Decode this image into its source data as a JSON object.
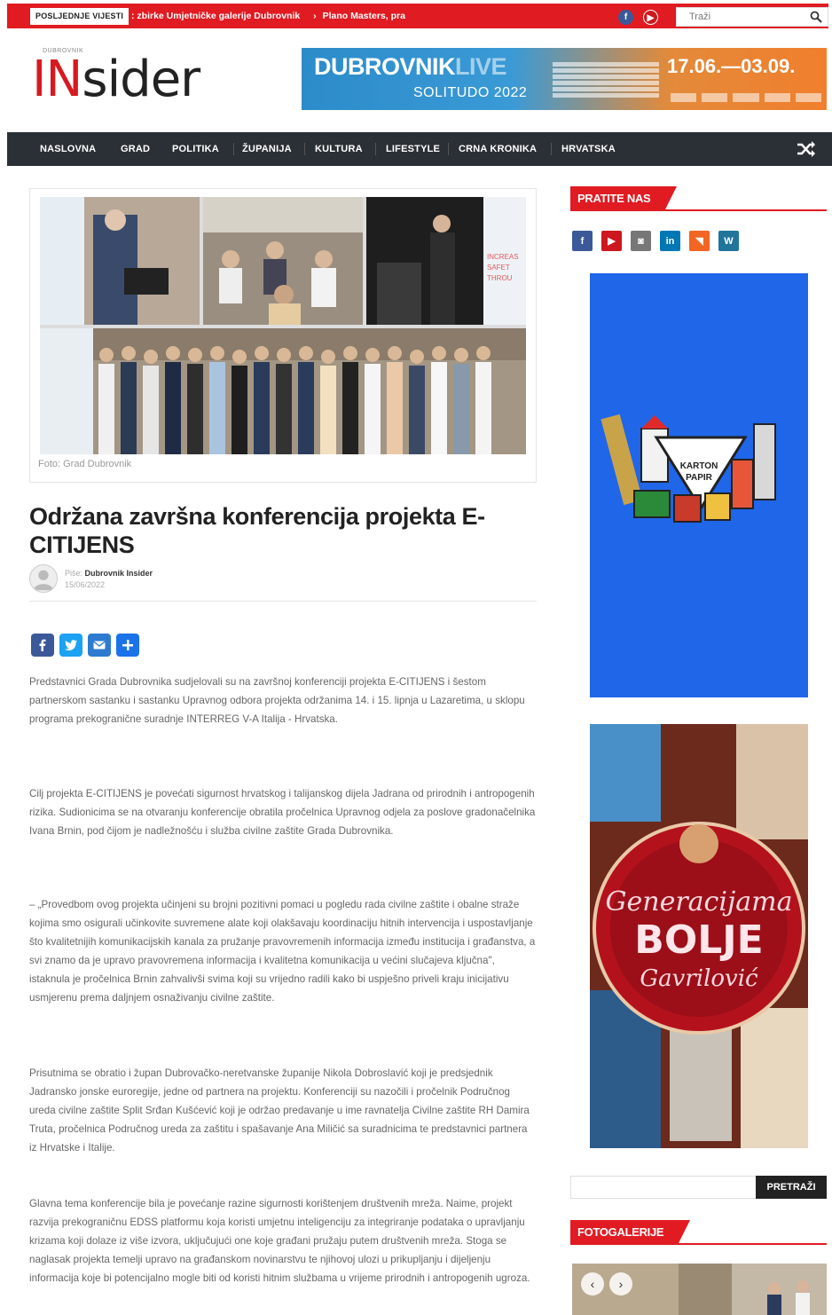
{
  "topbar": {
    "latest_label": "POSLJEDNJE VIJESTI",
    "ticker": [
      ": zbirke Umjetničke galerije Dubrovnik",
      "Plano Masters, pra"
    ],
    "search_placeholder": "Traži",
    "social_icons": [
      "facebook-icon",
      "youtube-icon"
    ]
  },
  "header": {
    "logo_small": "DUBROVNIK",
    "logo_in": "IN",
    "logo_sider": "sider",
    "banner": {
      "title_a": "DUBROVNIK",
      "title_b": "LIVE",
      "subtitle": "SOLITUDO 2022",
      "dates": "17.06.—03.09."
    }
  },
  "nav": {
    "items": [
      "NASLOVNA",
      "GRAD",
      "POLITIKA",
      "ŽUPANIJA",
      "KULTURA",
      "LIFESTYLE",
      "CRNA KRONIKA",
      "HRVATSKA"
    ]
  },
  "article": {
    "photo_caption": "Foto: Grad Dubrovnik",
    "collage_text": "INCREASING SAFETY THROUGH SOCIAL MEDIA BASED TOOLS",
    "title": "Održana završna konferencija projekta E-CITIJENS",
    "author_prefix": "Piše:",
    "author": "Dubrovnik Insider",
    "date": "15/06/2022",
    "paragraphs": [
      "Predstavnici Grada Dubrovnika sudjelovali su na završnoj konferenciji projekta E-CITIJENS i šestom partnerskom sastanku i sastanku Upravnog odbora projekta održanima 14. i 15. lipnja u Lazaretima, u sklopu programa prekogranične suradnje INTERREG V-A Italija - Hrvatska.",
      "Cilj projekta E-CITIJENS  je povećati sigurnost hrvatskog i talijanskog dijela Jadrana od prirodnih i antropogenih rizika. Sudionicima se na otvaranju konferencije obratila pročelnica Upravnog odjela za poslove gradonačelnika Ivana Brnin, pod čijom je nadležnošću i služba civilne zaštite Grada Dubrovnika.",
      "–  „Provedbom ovog projekta učinjeni su brojni pozitivni pomaci u pogledu rada civilne zaštite i obalne straže kojima smo osigurali učinkovite suvremene alate koji olakšavaju koordinaciju hitnih intervencija i uspostavljanje što kvalitetnijih komunikacijskih kanala za pružanje pravovremenih informacija između institucija i građanstva, a svi znamo da je upravo pravovremena informacija i kvalitetna komunikacija u većini slučajeva ključna\", istaknula je pročelnica Brnin zahvalivši svima koji su vrijedno radili kako bi uspješno priveli kraju inicijativu usmjerenu prema daljnjem osnaživanju civilne zaštite.",
      "Prisutnima se obratio i župan Dubrovačko-neretvanske županije Nikola Dobroslavić koji je predsjednik Jadransko jonske euroregije, jedne od partnera na projektu. Konferenciji su nazočili i pročelnik Područnog ureda civilne zaštite Split Srđan Kušćević koji je održao predavanje u ime ravnatelja Civilne zaštite RH Damira Truta, pročelnica Područnog ureda za zaštitu i spašavanje Ana Miličić sa suradnicima te predstavnici partnera iz Hrvatske i Italije.",
      "Glavna tema konferencije bila je povećanje razine sigurnosti korištenjem društvenih mreža. Naime, projekt razvija prekograničnu EDSS platformu koja koristi umjetnu inteligenciju za integriranje podataka o upravljanju krizama koji dolaze iz više izvora, uključujući one koje građani pružaju putem društvenih mreža. Stoga se naglasak projekta temelji upravo na građanskom novinarstvu te njihovoj ulozi u prikupljanju i dijeljenju informacija koje bi potencijalno mogle biti od koristi hitnim službama u vrijeme prirodnih i antropogenih ugroza."
    ],
    "share_icons": [
      "facebook-share-icon",
      "twitter-share-icon",
      "email-share-icon",
      "add-share-icon"
    ]
  },
  "sidebar": {
    "follow_title": "PRATITE NAS",
    "follow_icons": [
      {
        "name": "facebook-icon",
        "glyph": "f",
        "color": "#3b5998"
      },
      {
        "name": "youtube-icon",
        "glyph": "▶",
        "color": "#cc181e"
      },
      {
        "name": "instagram-icon",
        "glyph": "◙",
        "color": "#777777"
      },
      {
        "name": "linkedin-icon",
        "glyph": "in",
        "color": "#0077b5"
      },
      {
        "name": "rss-icon",
        "glyph": "◥",
        "color": "#f26522"
      },
      {
        "name": "wordpress-icon",
        "glyph": "W",
        "color": "#21759b"
      }
    ],
    "ad1": {
      "line1": "KARTON",
      "line2": "PAPIR"
    },
    "ad2": {
      "line1": "Generacijama",
      "line2": "BOLJE",
      "line3": "Gavrilović"
    },
    "search_button": "PRETRAŽI",
    "gallery_title": "FOTOGALERIJE"
  },
  "colors": {
    "brand_red": "#e01b22",
    "nav_dark": "#2b3036"
  }
}
